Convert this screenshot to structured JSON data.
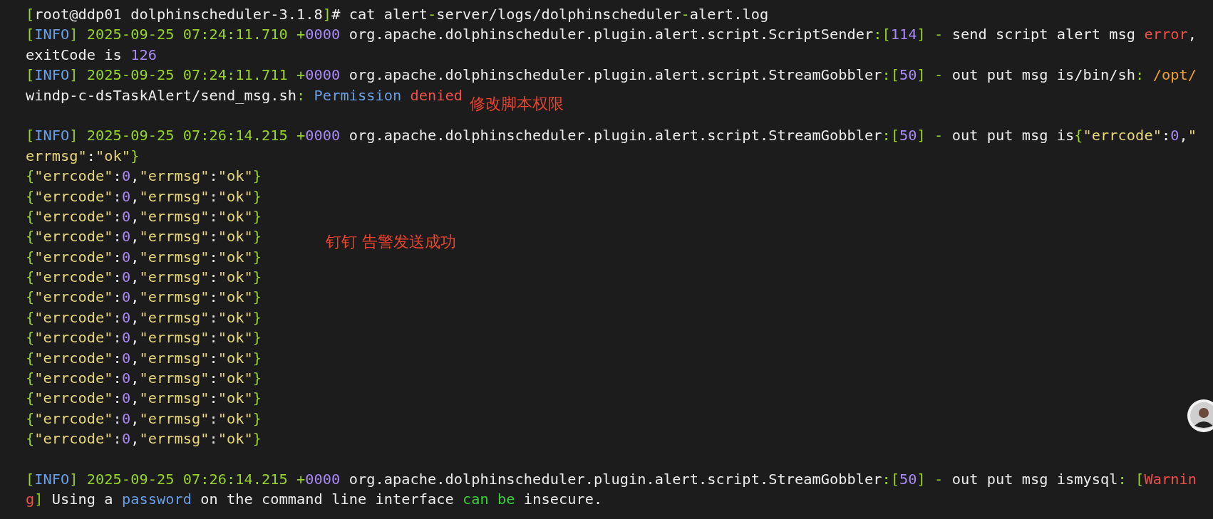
{
  "terminal": {
    "lines": [
      {
        "kind": "text",
        "segments": [
          {
            "text": "[",
            "color": "#98d42a"
          },
          {
            "text": "root@ddp01 dolphinscheduler-3.1.8",
            "color": "#ececec"
          },
          {
            "text": "]",
            "color": "#98d42a"
          },
          {
            "text": "# cat alert",
            "color": "#ececec"
          },
          {
            "text": "-",
            "color": "#98d42a"
          },
          {
            "text": "server/logs/dolphinscheduler",
            "color": "#ececec"
          },
          {
            "text": "-",
            "color": "#98d42a"
          },
          {
            "text": "alert.log",
            "color": "#ececec"
          }
        ]
      },
      {
        "kind": "text",
        "segments": [
          {
            "text": "[",
            "color": "#98d42a"
          },
          {
            "text": "INFO",
            "color": "#6a9fe6"
          },
          {
            "text": "] 2025-09-25 07:24:11.710 +",
            "color": "#98d42a"
          },
          {
            "text": "0000",
            "color": "#a98af5"
          },
          {
            "text": " org.apache.dolphinscheduler.plugin.alert.script.ScriptSender",
            "color": "#ececec"
          },
          {
            "text": ":[",
            "color": "#98d42a"
          },
          {
            "text": "114",
            "color": "#a98af5"
          },
          {
            "text": "] - ",
            "color": "#98d42a"
          },
          {
            "text": "send script alert msg ",
            "color": "#ececec"
          },
          {
            "text": "error",
            "color": "#f0504a"
          },
          {
            "text": ",",
            "color": "#ececec"
          }
        ]
      },
      {
        "kind": "text",
        "segments": [
          {
            "text": "exitCode is ",
            "color": "#ececec"
          },
          {
            "text": "126",
            "color": "#a98af5"
          }
        ]
      },
      {
        "kind": "text",
        "segments": [
          {
            "text": "[",
            "color": "#98d42a"
          },
          {
            "text": "INFO",
            "color": "#6a9fe6"
          },
          {
            "text": "] 2025-09-25 07:24:11.711 +",
            "color": "#98d42a"
          },
          {
            "text": "0000",
            "color": "#a98af5"
          },
          {
            "text": " org.apache.dolphinscheduler.plugin.alert.script.StreamGobbler",
            "color": "#ececec"
          },
          {
            "text": ":[",
            "color": "#98d42a"
          },
          {
            "text": "50",
            "color": "#a98af5"
          },
          {
            "text": "] - ",
            "color": "#98d42a"
          },
          {
            "text": "out put msg is/bin/sh",
            "color": "#ececec"
          },
          {
            "text": ": ",
            "color": "#98d42a"
          },
          {
            "text": "/opt/",
            "color": "#f0a030"
          }
        ]
      },
      {
        "kind": "text",
        "note": "修改脚本权限",
        "segments": [
          {
            "text": "windp-c-dsTaskAlert/send_msg.sh",
            "color": "#ececec"
          },
          {
            "text": ": ",
            "color": "#98d42a"
          },
          {
            "text": "Permission",
            "color": "#6a9fe6"
          },
          {
            "text": " denied",
            "color": "#f0504a"
          }
        ]
      },
      {
        "kind": "blank"
      },
      {
        "kind": "text",
        "segments": [
          {
            "text": "[",
            "color": "#98d42a"
          },
          {
            "text": "INFO",
            "color": "#6a9fe6"
          },
          {
            "text": "] 2025-09-25 07:26:14.215 +",
            "color": "#98d42a"
          },
          {
            "text": "0000",
            "color": "#a98af5"
          },
          {
            "text": " org.apache.dolphinscheduler.plugin.alert.script.StreamGobbler",
            "color": "#ececec"
          },
          {
            "text": ":[",
            "color": "#98d42a"
          },
          {
            "text": "50",
            "color": "#a98af5"
          },
          {
            "text": "] - ",
            "color": "#98d42a"
          },
          {
            "text": "out put msg is",
            "color": "#ececec"
          },
          {
            "text": "{",
            "color": "#98d42a"
          },
          {
            "text": "\"errcode\"",
            "color": "#e6d67a"
          },
          {
            "text": ":",
            "color": "#ececec"
          },
          {
            "text": "0",
            "color": "#a98af5"
          },
          {
            "text": ",",
            "color": "#ececec"
          },
          {
            "text": "\"",
            "color": "#e6d67a"
          }
        ]
      },
      {
        "kind": "text",
        "segments": [
          {
            "text": "errmsg\"",
            "color": "#e6d67a"
          },
          {
            "text": ":",
            "color": "#ececec"
          },
          {
            "text": "\"ok\"",
            "color": "#e6d67a"
          },
          {
            "text": "}",
            "color": "#98d42a"
          }
        ]
      },
      {
        "kind": "text",
        "segments": [
          {
            "text": "{",
            "color": "#98d42a"
          },
          {
            "text": "\"errcode\"",
            "color": "#e6d67a"
          },
          {
            "text": ":",
            "color": "#ececec"
          },
          {
            "text": "0",
            "color": "#a98af5"
          },
          {
            "text": ",",
            "color": "#ececec"
          },
          {
            "text": "\"errmsg\"",
            "color": "#e6d67a"
          },
          {
            "text": ":",
            "color": "#ececec"
          },
          {
            "text": "\"ok\"",
            "color": "#e6d67a"
          },
          {
            "text": "}",
            "color": "#98d42a"
          }
        ]
      },
      {
        "kind": "text",
        "segments": [
          {
            "text": "{",
            "color": "#98d42a"
          },
          {
            "text": "\"errcode\"",
            "color": "#e6d67a"
          },
          {
            "text": ":",
            "color": "#ececec"
          },
          {
            "text": "0",
            "color": "#a98af5"
          },
          {
            "text": ",",
            "color": "#ececec"
          },
          {
            "text": "\"errmsg\"",
            "color": "#e6d67a"
          },
          {
            "text": ":",
            "color": "#ececec"
          },
          {
            "text": "\"ok\"",
            "color": "#e6d67a"
          },
          {
            "text": "}",
            "color": "#98d42a"
          }
        ]
      },
      {
        "kind": "text",
        "segments": [
          {
            "text": "{",
            "color": "#98d42a"
          },
          {
            "text": "\"errcode\"",
            "color": "#e6d67a"
          },
          {
            "text": ":",
            "color": "#ececec"
          },
          {
            "text": "0",
            "color": "#a98af5"
          },
          {
            "text": ",",
            "color": "#ececec"
          },
          {
            "text": "\"errmsg\"",
            "color": "#e6d67a"
          },
          {
            "text": ":",
            "color": "#ececec"
          },
          {
            "text": "\"ok\"",
            "color": "#e6d67a"
          },
          {
            "text": "}",
            "color": "#98d42a"
          }
        ]
      },
      {
        "kind": "text",
        "note": "钉钉 告警发送成功",
        "segments": [
          {
            "text": "{",
            "color": "#98d42a"
          },
          {
            "text": "\"errcode\"",
            "color": "#e6d67a"
          },
          {
            "text": ":",
            "color": "#ececec"
          },
          {
            "text": "0",
            "color": "#a98af5"
          },
          {
            "text": ",",
            "color": "#ececec"
          },
          {
            "text": "\"errmsg\"",
            "color": "#e6d67a"
          },
          {
            "text": ":",
            "color": "#ececec"
          },
          {
            "text": "\"ok\"",
            "color": "#e6d67a"
          },
          {
            "text": "}",
            "color": "#98d42a"
          }
        ]
      },
      {
        "kind": "text",
        "segments": [
          {
            "text": "{",
            "color": "#98d42a"
          },
          {
            "text": "\"errcode\"",
            "color": "#e6d67a"
          },
          {
            "text": ":",
            "color": "#ececec"
          },
          {
            "text": "0",
            "color": "#a98af5"
          },
          {
            "text": ",",
            "color": "#ececec"
          },
          {
            "text": "\"errmsg\"",
            "color": "#e6d67a"
          },
          {
            "text": ":",
            "color": "#ececec"
          },
          {
            "text": "\"ok\"",
            "color": "#e6d67a"
          },
          {
            "text": "}",
            "color": "#98d42a"
          }
        ]
      },
      {
        "kind": "text",
        "segments": [
          {
            "text": "{",
            "color": "#98d42a"
          },
          {
            "text": "\"errcode\"",
            "color": "#e6d67a"
          },
          {
            "text": ":",
            "color": "#ececec"
          },
          {
            "text": "0",
            "color": "#a98af5"
          },
          {
            "text": ",",
            "color": "#ececec"
          },
          {
            "text": "\"errmsg\"",
            "color": "#e6d67a"
          },
          {
            "text": ":",
            "color": "#ececec"
          },
          {
            "text": "\"ok\"",
            "color": "#e6d67a"
          },
          {
            "text": "}",
            "color": "#98d42a"
          }
        ]
      },
      {
        "kind": "text",
        "segments": [
          {
            "text": "{",
            "color": "#98d42a"
          },
          {
            "text": "\"errcode\"",
            "color": "#e6d67a"
          },
          {
            "text": ":",
            "color": "#ececec"
          },
          {
            "text": "0",
            "color": "#a98af5"
          },
          {
            "text": ",",
            "color": "#ececec"
          },
          {
            "text": "\"errmsg\"",
            "color": "#e6d67a"
          },
          {
            "text": ":",
            "color": "#ececec"
          },
          {
            "text": "\"ok\"",
            "color": "#e6d67a"
          },
          {
            "text": "}",
            "color": "#98d42a"
          }
        ]
      },
      {
        "kind": "text",
        "segments": [
          {
            "text": "{",
            "color": "#98d42a"
          },
          {
            "text": "\"errcode\"",
            "color": "#e6d67a"
          },
          {
            "text": ":",
            "color": "#ececec"
          },
          {
            "text": "0",
            "color": "#a98af5"
          },
          {
            "text": ",",
            "color": "#ececec"
          },
          {
            "text": "\"errmsg\"",
            "color": "#e6d67a"
          },
          {
            "text": ":",
            "color": "#ececec"
          },
          {
            "text": "\"ok\"",
            "color": "#e6d67a"
          },
          {
            "text": "}",
            "color": "#98d42a"
          }
        ]
      },
      {
        "kind": "text",
        "segments": [
          {
            "text": "{",
            "color": "#98d42a"
          },
          {
            "text": "\"errcode\"",
            "color": "#e6d67a"
          },
          {
            "text": ":",
            "color": "#ececec"
          },
          {
            "text": "0",
            "color": "#a98af5"
          },
          {
            "text": ",",
            "color": "#ececec"
          },
          {
            "text": "\"errmsg\"",
            "color": "#e6d67a"
          },
          {
            "text": ":",
            "color": "#ececec"
          },
          {
            "text": "\"ok\"",
            "color": "#e6d67a"
          },
          {
            "text": "}",
            "color": "#98d42a"
          }
        ]
      },
      {
        "kind": "text",
        "segments": [
          {
            "text": "{",
            "color": "#98d42a"
          },
          {
            "text": "\"errcode\"",
            "color": "#e6d67a"
          },
          {
            "text": ":",
            "color": "#ececec"
          },
          {
            "text": "0",
            "color": "#a98af5"
          },
          {
            "text": ",",
            "color": "#ececec"
          },
          {
            "text": "\"errmsg\"",
            "color": "#e6d67a"
          },
          {
            "text": ":",
            "color": "#ececec"
          },
          {
            "text": "\"ok\"",
            "color": "#e6d67a"
          },
          {
            "text": "}",
            "color": "#98d42a"
          }
        ]
      },
      {
        "kind": "text",
        "segments": [
          {
            "text": "{",
            "color": "#98d42a"
          },
          {
            "text": "\"errcode\"",
            "color": "#e6d67a"
          },
          {
            "text": ":",
            "color": "#ececec"
          },
          {
            "text": "0",
            "color": "#a98af5"
          },
          {
            "text": ",",
            "color": "#ececec"
          },
          {
            "text": "\"errmsg\"",
            "color": "#e6d67a"
          },
          {
            "text": ":",
            "color": "#ececec"
          },
          {
            "text": "\"ok\"",
            "color": "#e6d67a"
          },
          {
            "text": "}",
            "color": "#98d42a"
          }
        ]
      },
      {
        "kind": "text",
        "segments": [
          {
            "text": "{",
            "color": "#98d42a"
          },
          {
            "text": "\"errcode\"",
            "color": "#e6d67a"
          },
          {
            "text": ":",
            "color": "#ececec"
          },
          {
            "text": "0",
            "color": "#a98af5"
          },
          {
            "text": ",",
            "color": "#ececec"
          },
          {
            "text": "\"errmsg\"",
            "color": "#e6d67a"
          },
          {
            "text": ":",
            "color": "#ececec"
          },
          {
            "text": "\"ok\"",
            "color": "#e6d67a"
          },
          {
            "text": "}",
            "color": "#98d42a"
          }
        ]
      },
      {
        "kind": "text",
        "segments": [
          {
            "text": "{",
            "color": "#98d42a"
          },
          {
            "text": "\"errcode\"",
            "color": "#e6d67a"
          },
          {
            "text": ":",
            "color": "#ececec"
          },
          {
            "text": "0",
            "color": "#a98af5"
          },
          {
            "text": ",",
            "color": "#ececec"
          },
          {
            "text": "\"errmsg\"",
            "color": "#e6d67a"
          },
          {
            "text": ":",
            "color": "#ececec"
          },
          {
            "text": "\"ok\"",
            "color": "#e6d67a"
          },
          {
            "text": "}",
            "color": "#98d42a"
          }
        ]
      },
      {
        "kind": "text",
        "segments": [
          {
            "text": "{",
            "color": "#98d42a"
          },
          {
            "text": "\"errcode\"",
            "color": "#e6d67a"
          },
          {
            "text": ":",
            "color": "#ececec"
          },
          {
            "text": "0",
            "color": "#a98af5"
          },
          {
            "text": ",",
            "color": "#ececec"
          },
          {
            "text": "\"errmsg\"",
            "color": "#e6d67a"
          },
          {
            "text": ":",
            "color": "#ececec"
          },
          {
            "text": "\"ok\"",
            "color": "#e6d67a"
          },
          {
            "text": "}",
            "color": "#98d42a"
          }
        ]
      },
      {
        "kind": "blank"
      },
      {
        "kind": "text",
        "segments": [
          {
            "text": "[",
            "color": "#98d42a"
          },
          {
            "text": "INFO",
            "color": "#6a9fe6"
          },
          {
            "text": "] 2025-09-25 07:26:14.215 +",
            "color": "#98d42a"
          },
          {
            "text": "0000",
            "color": "#a98af5"
          },
          {
            "text": " org.apache.dolphinscheduler.plugin.alert.script.StreamGobbler",
            "color": "#ececec"
          },
          {
            "text": ":[",
            "color": "#98d42a"
          },
          {
            "text": "50",
            "color": "#a98af5"
          },
          {
            "text": "] - ",
            "color": "#98d42a"
          },
          {
            "text": "out put msg ismysql",
            "color": "#ececec"
          },
          {
            "text": ": [",
            "color": "#98d42a"
          },
          {
            "text": "Warnin",
            "color": "#f0504a"
          }
        ]
      },
      {
        "kind": "text",
        "segments": [
          {
            "text": "g",
            "color": "#f0504a"
          },
          {
            "text": "]",
            "color": "#98d42a"
          },
          {
            "text": " Using a ",
            "color": "#ececec"
          },
          {
            "text": "password",
            "color": "#6a9fe6"
          },
          {
            "text": " on the command line interface ",
            "color": "#ececec"
          },
          {
            "text": "can be",
            "color": "#3ccf3c"
          },
          {
            "text": " insecure.",
            "color": "#ececec"
          }
        ]
      }
    ]
  }
}
